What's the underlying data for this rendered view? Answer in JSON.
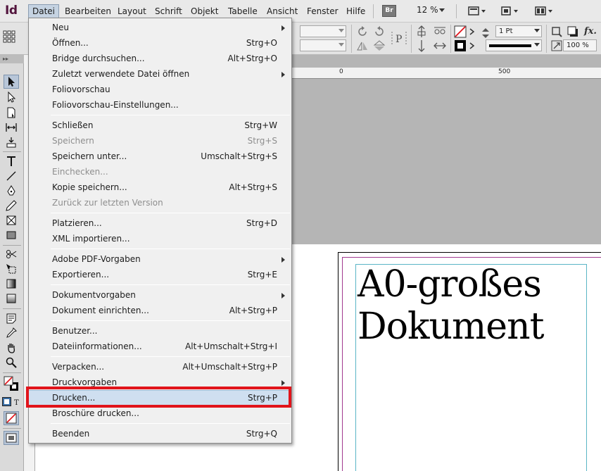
{
  "app": {
    "logo": "Id"
  },
  "menubar": {
    "items": [
      "Datei",
      "Bearbeiten",
      "Layout",
      "Schrift",
      "Objekt",
      "Tabelle",
      "Ansicht",
      "Fenster",
      "Hilfe"
    ],
    "bridge_badge": "Br",
    "zoom": "12 %"
  },
  "controlbar": {
    "stroke_weight": "1 Pt",
    "scale": "100 %",
    "fx": "fx."
  },
  "ruler": {
    "marks": [
      "0",
      "500"
    ]
  },
  "document": {
    "heading": "A0-großes Dokument"
  },
  "file_menu": {
    "items": [
      {
        "label": "Neu",
        "shortcut": "",
        "submenu": true,
        "enabled": true
      },
      {
        "label": "Öffnen...",
        "shortcut": "Strg+O",
        "submenu": false,
        "enabled": true
      },
      {
        "label": "Bridge durchsuchen...",
        "shortcut": "Alt+Strg+O",
        "submenu": false,
        "enabled": true
      },
      {
        "label": "Zuletzt verwendete Datei öffnen",
        "shortcut": "",
        "submenu": true,
        "enabled": true
      },
      {
        "label": "Foliovorschau",
        "shortcut": "",
        "submenu": false,
        "enabled": true
      },
      {
        "label": "Foliovorschau-Einstellungen...",
        "shortcut": "",
        "submenu": false,
        "enabled": true
      },
      {
        "label": "Schließen",
        "shortcut": "Strg+W",
        "submenu": false,
        "enabled": true
      },
      {
        "label": "Speichern",
        "shortcut": "Strg+S",
        "submenu": false,
        "enabled": false
      },
      {
        "label": "Speichern unter...",
        "shortcut": "Umschalt+Strg+S",
        "submenu": false,
        "enabled": true
      },
      {
        "label": "Einchecken...",
        "shortcut": "",
        "submenu": false,
        "enabled": false
      },
      {
        "label": "Kopie speichern...",
        "shortcut": "Alt+Strg+S",
        "submenu": false,
        "enabled": true
      },
      {
        "label": "Zurück zur letzten Version",
        "shortcut": "",
        "submenu": false,
        "enabled": false
      },
      {
        "label": "Platzieren...",
        "shortcut": "Strg+D",
        "submenu": false,
        "enabled": true
      },
      {
        "label": "XML importieren...",
        "shortcut": "",
        "submenu": false,
        "enabled": true
      },
      {
        "label": "Adobe PDF-Vorgaben",
        "shortcut": "",
        "submenu": true,
        "enabled": true
      },
      {
        "label": "Exportieren...",
        "shortcut": "Strg+E",
        "submenu": false,
        "enabled": true
      },
      {
        "label": "Dokumentvorgaben",
        "shortcut": "",
        "submenu": true,
        "enabled": true
      },
      {
        "label": "Dokument einrichten...",
        "shortcut": "Alt+Strg+P",
        "submenu": false,
        "enabled": true
      },
      {
        "label": "Benutzer...",
        "shortcut": "",
        "submenu": false,
        "enabled": true
      },
      {
        "label": "Dateiinformationen...",
        "shortcut": "Alt+Umschalt+Strg+I",
        "submenu": false,
        "enabled": true
      },
      {
        "label": "Verpacken...",
        "shortcut": "Alt+Umschalt+Strg+P",
        "submenu": false,
        "enabled": true
      },
      {
        "label": "Druckvorgaben",
        "shortcut": "",
        "submenu": true,
        "enabled": true
      },
      {
        "label": "Drucken...",
        "shortcut": "Strg+P",
        "submenu": false,
        "enabled": true,
        "highlighted": true
      },
      {
        "label": "Broschüre drucken...",
        "shortcut": "",
        "submenu": false,
        "enabled": true
      },
      {
        "label": "Beenden",
        "shortcut": "Strg+Q",
        "submenu": false,
        "enabled": true
      }
    ]
  },
  "colors": {
    "highlight_outline": "#e1141b",
    "menu_hover": "#cfdff0",
    "logo": "#52143d",
    "margin_guide": "#a0398f",
    "frame_guide": "#5ab5c6"
  }
}
